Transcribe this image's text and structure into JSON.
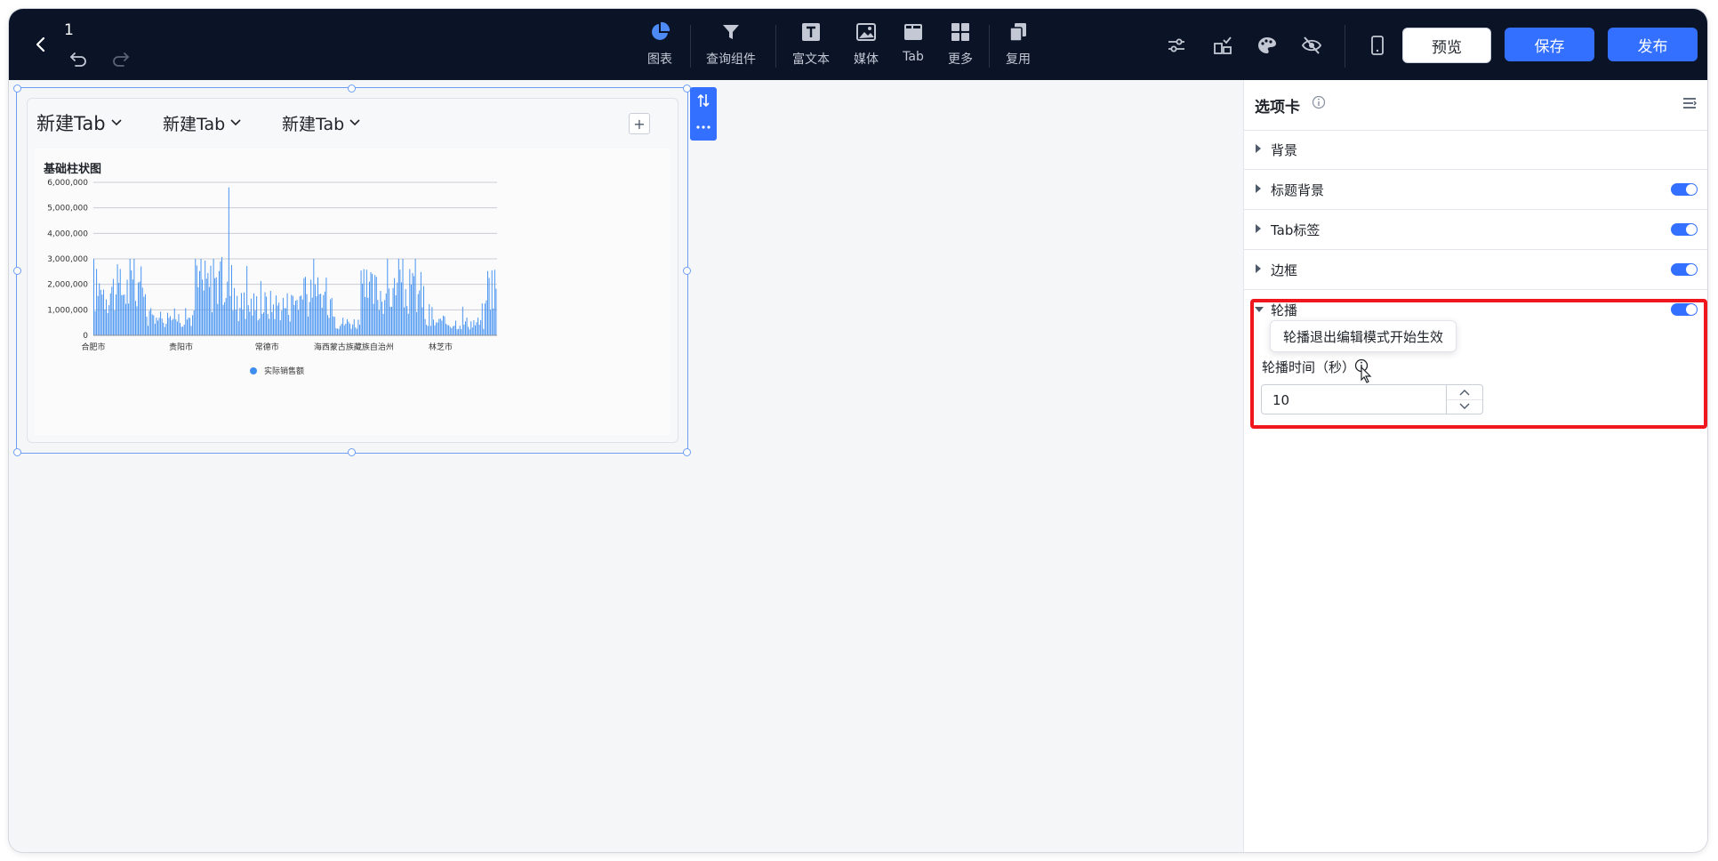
{
  "header": {
    "doc_title": "1",
    "tools": [
      {
        "label": "图表",
        "icon": "pie-chart-icon"
      },
      {
        "label": "查询组件",
        "icon": "filter-icon"
      },
      {
        "label": "富文本",
        "icon": "text-icon"
      },
      {
        "label": "媒体",
        "icon": "image-icon"
      },
      {
        "label": "Tab",
        "icon": "tab-icon"
      },
      {
        "label": "更多",
        "icon": "grid-icon"
      },
      {
        "label": "复用",
        "icon": "copy-icon"
      }
    ],
    "right_icons": [
      "sliders-icon",
      "layout-check-icon",
      "palette-icon",
      "eye-off-icon",
      "mobile-icon"
    ],
    "buttons": {
      "preview": "预览",
      "save": "保存",
      "publish": "发布"
    },
    "accent_color": "#3370ff"
  },
  "widget": {
    "tabs": [
      "新建Tab",
      "新建Tab",
      "新建Tab"
    ],
    "add_label": "+"
  },
  "chart_data": {
    "type": "bar",
    "title": "基础柱状图",
    "series": [
      {
        "name": "实际销售额",
        "color": "#3d8ef0"
      }
    ],
    "x_tick_labels": [
      "合肥市",
      "贵阳市",
      "常德市",
      "海西蒙古族藏族自治州",
      "林芝市"
    ],
    "y_ticks": [
      "0",
      "1,000,000",
      "2,000,000",
      "3,000,000",
      "4,000,000",
      "5,000,000",
      "6,000,000"
    ],
    "ylim": [
      0,
      6000000
    ],
    "grid": true,
    "legend_position": "bottom-center",
    "bar_count": 290,
    "peak_value": 5800000
  },
  "panel": {
    "title": "选项卡",
    "sections": [
      {
        "label": "背景",
        "toggle": false
      },
      {
        "label": "标题背景",
        "toggle": true
      },
      {
        "label": "Tab标签",
        "toggle": true
      },
      {
        "label": "边框",
        "toggle": true
      },
      {
        "label": "轮播",
        "toggle": true
      }
    ],
    "carousel": {
      "tooltip": "轮播退出编辑模式开始生效",
      "time_label": "轮播时间（秒）",
      "time_value": "10"
    }
  }
}
